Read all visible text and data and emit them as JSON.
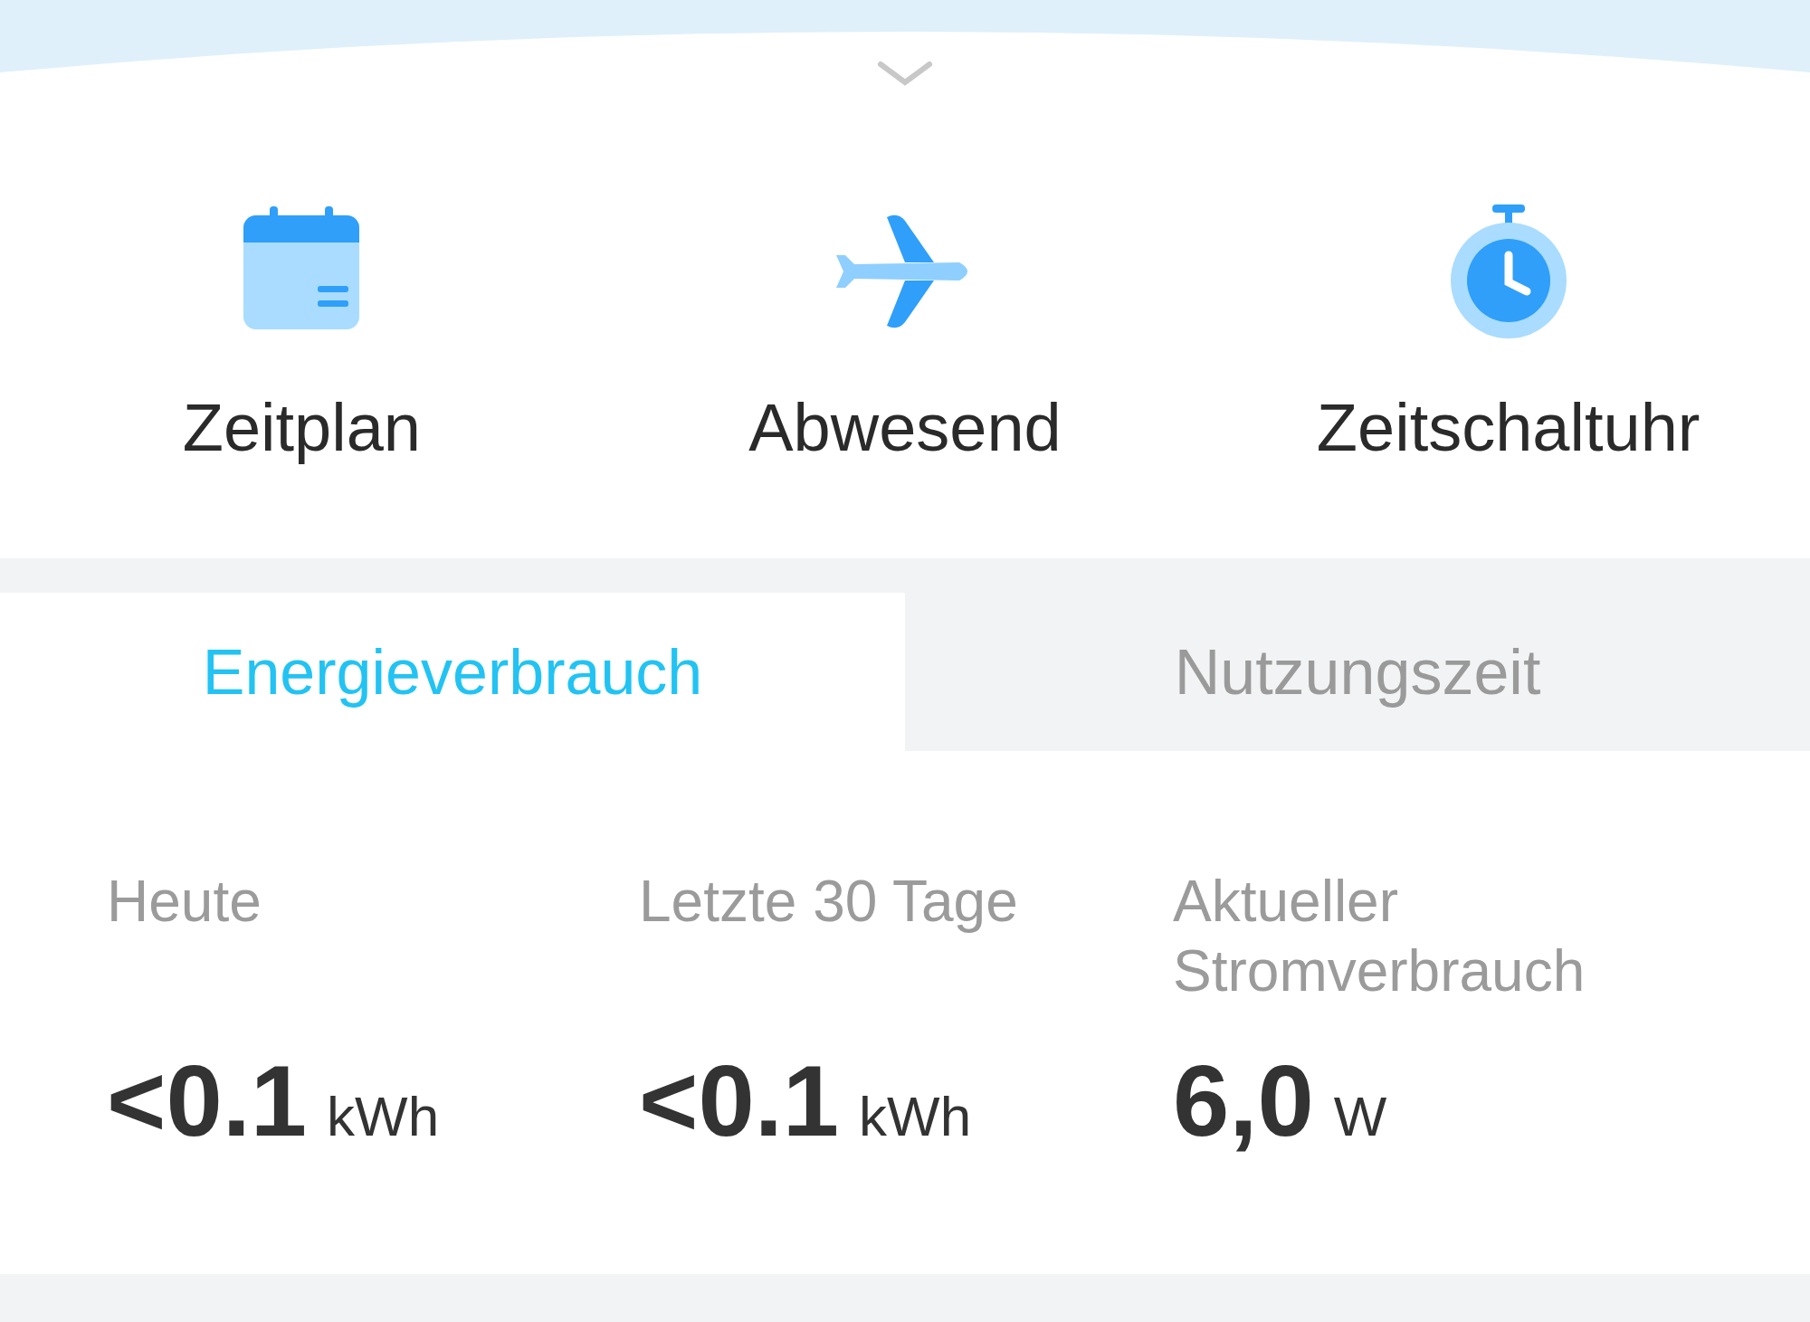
{
  "actions": [
    {
      "kind": "calendar",
      "label": "Zeitplan"
    },
    {
      "kind": "plane",
      "label": "Abwesend"
    },
    {
      "kind": "stopwatch",
      "label": "Zeitschaltuhr"
    }
  ],
  "tabs": [
    {
      "label": "Energieverbrauch",
      "selected": true
    },
    {
      "label": "Nutzungszeit",
      "selected": false
    }
  ],
  "stats": [
    {
      "label": "Heute",
      "value": "<0.1",
      "unit": "kWh"
    },
    {
      "label": "Letzte 30 Tage",
      "value": "<0.1",
      "unit": "kWh"
    },
    {
      "label": "Aktueller Stromverbrauch",
      "value": "6,0",
      "unit": "W"
    }
  ]
}
